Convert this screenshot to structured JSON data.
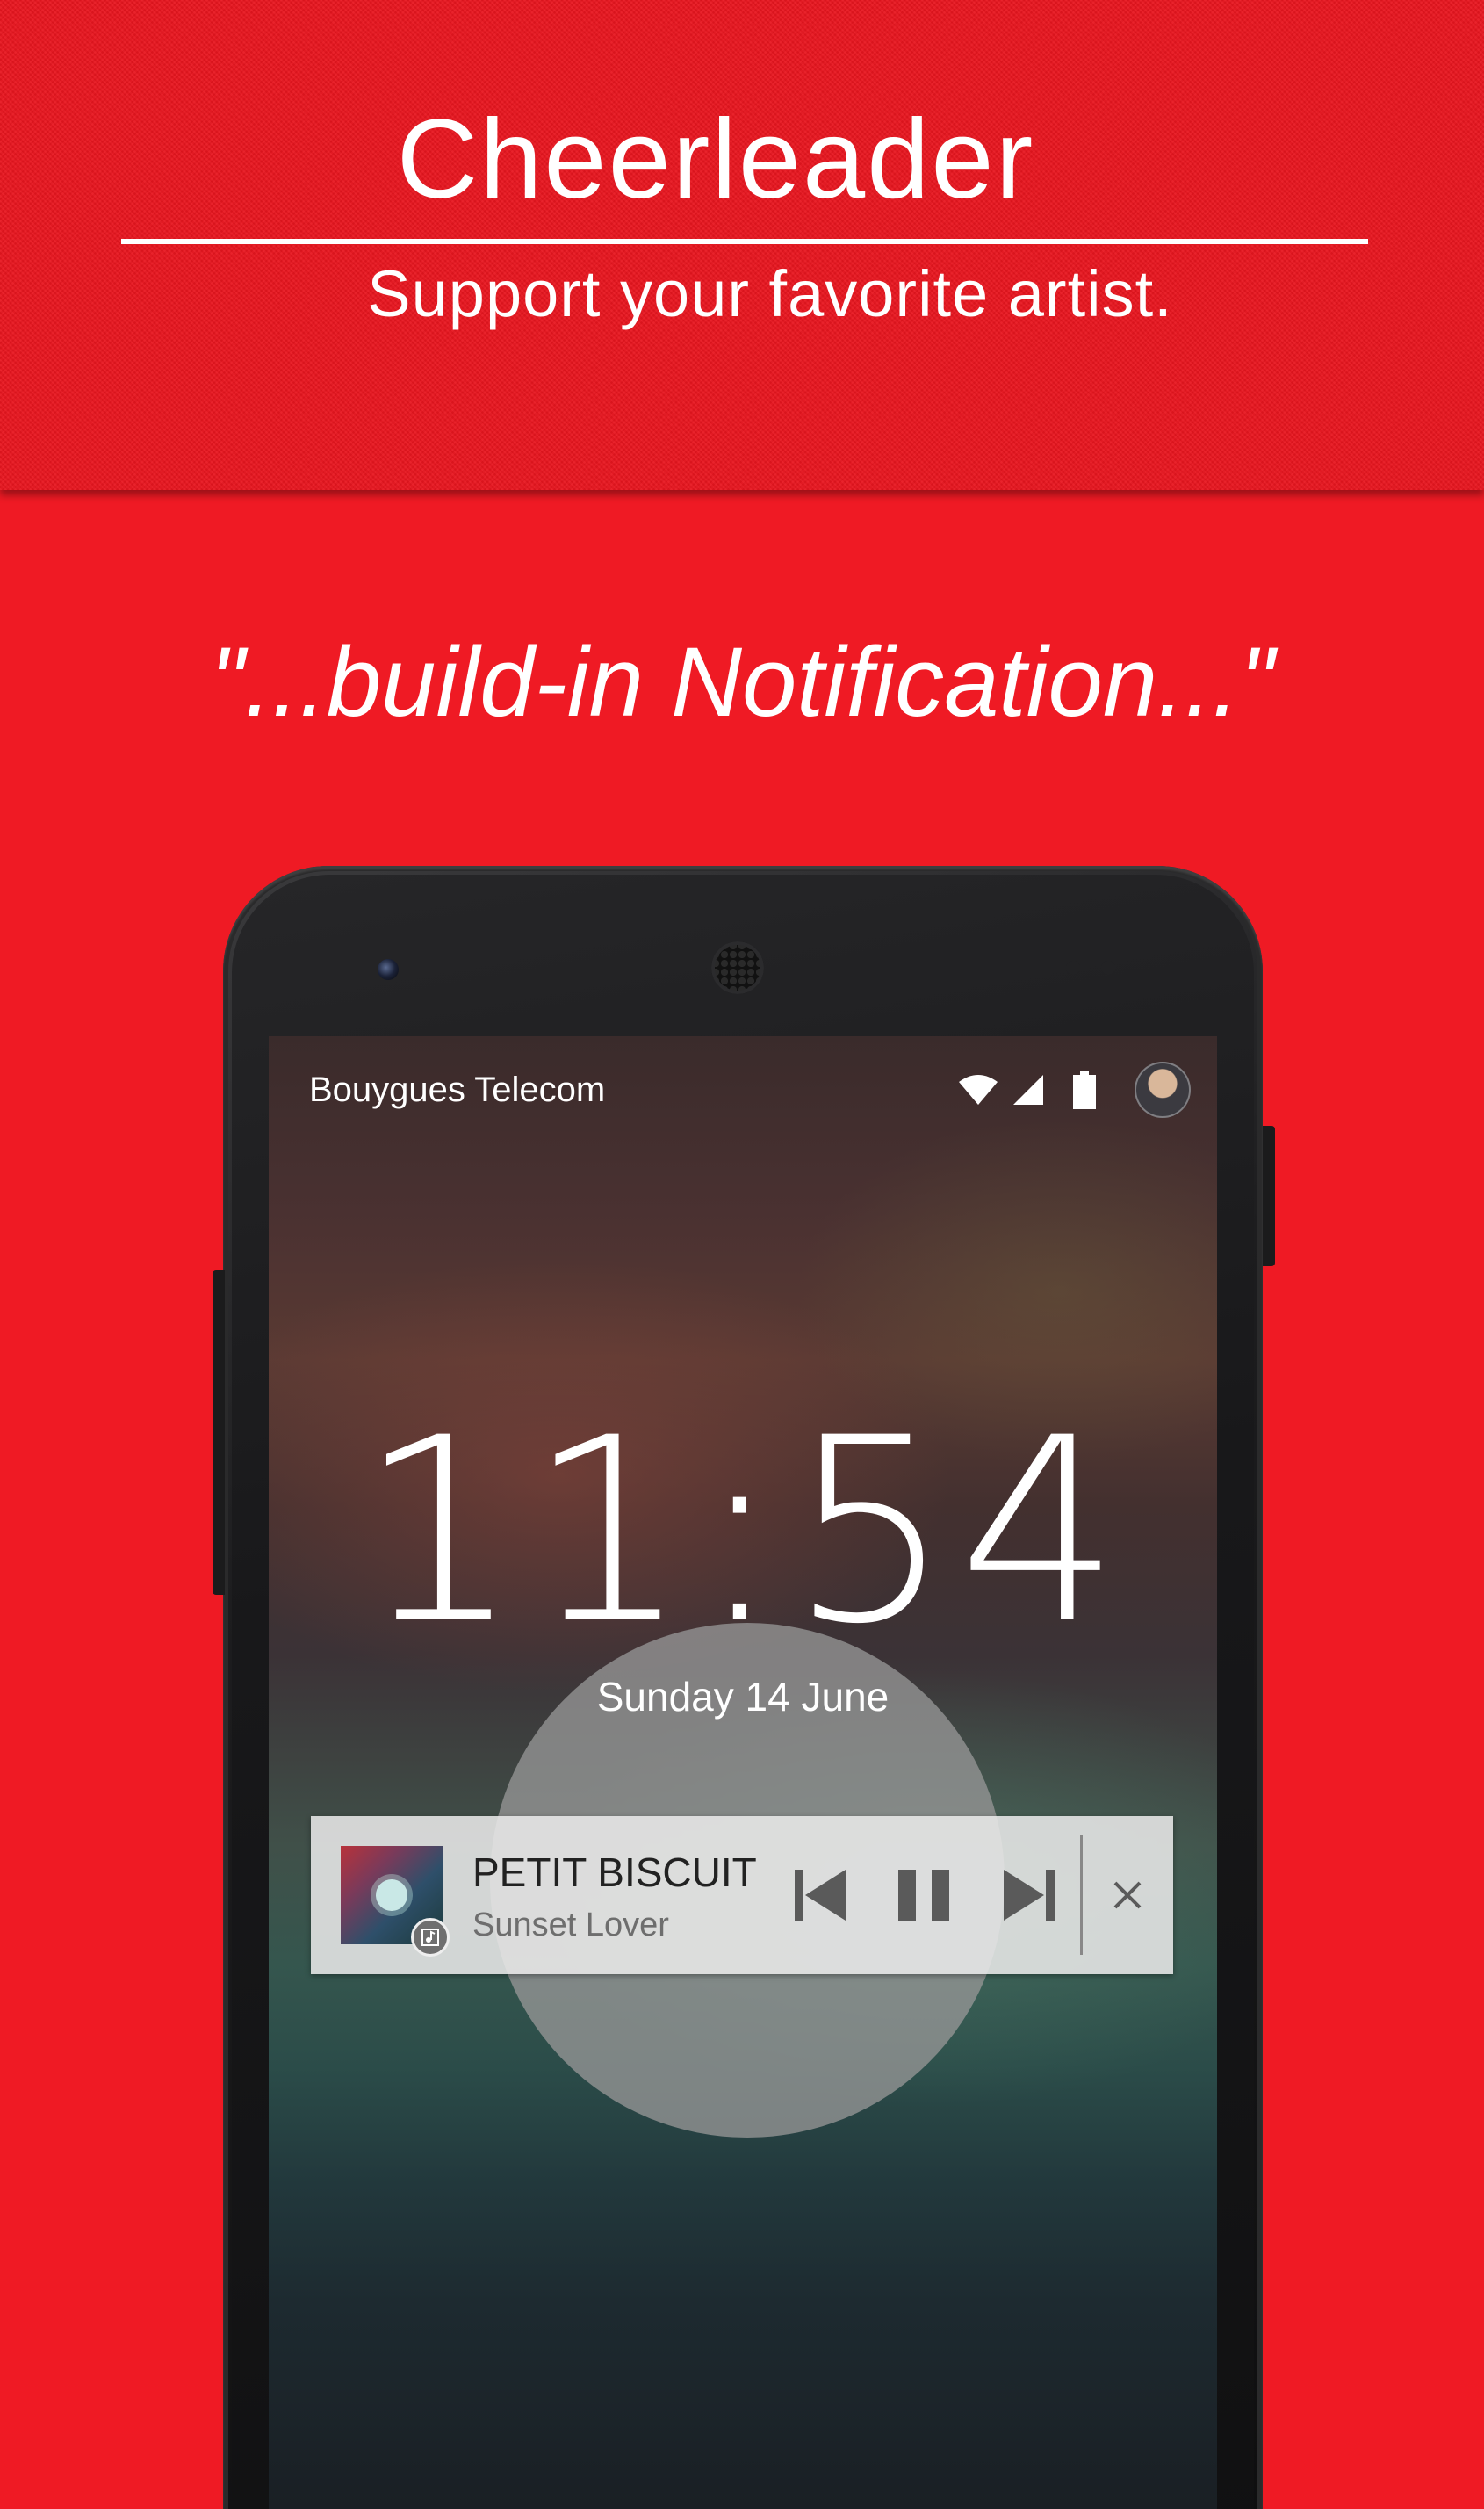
{
  "header": {
    "app_title": "Cheerleader",
    "tagline": "Support your favorite artist."
  },
  "quote": "\"...build-in Notification...\"",
  "lockscreen": {
    "carrier": "Bouygues Telecom",
    "time": "11:54",
    "date": "Sunday 14 June",
    "status_icons": [
      "wifi-icon",
      "signal-icon",
      "battery-icon",
      "avatar"
    ]
  },
  "notification": {
    "title": "PETIT BISCUIT",
    "subtitle": "Sunset Lover",
    "controls": [
      "previous-track-icon",
      "pause-icon",
      "next-track-icon",
      "close-icon"
    ]
  },
  "colors": {
    "background": "#ee1b24",
    "text": "#ffffff",
    "notification_bg": "#e8e8e8",
    "notification_controls": "#5a5a5a"
  }
}
